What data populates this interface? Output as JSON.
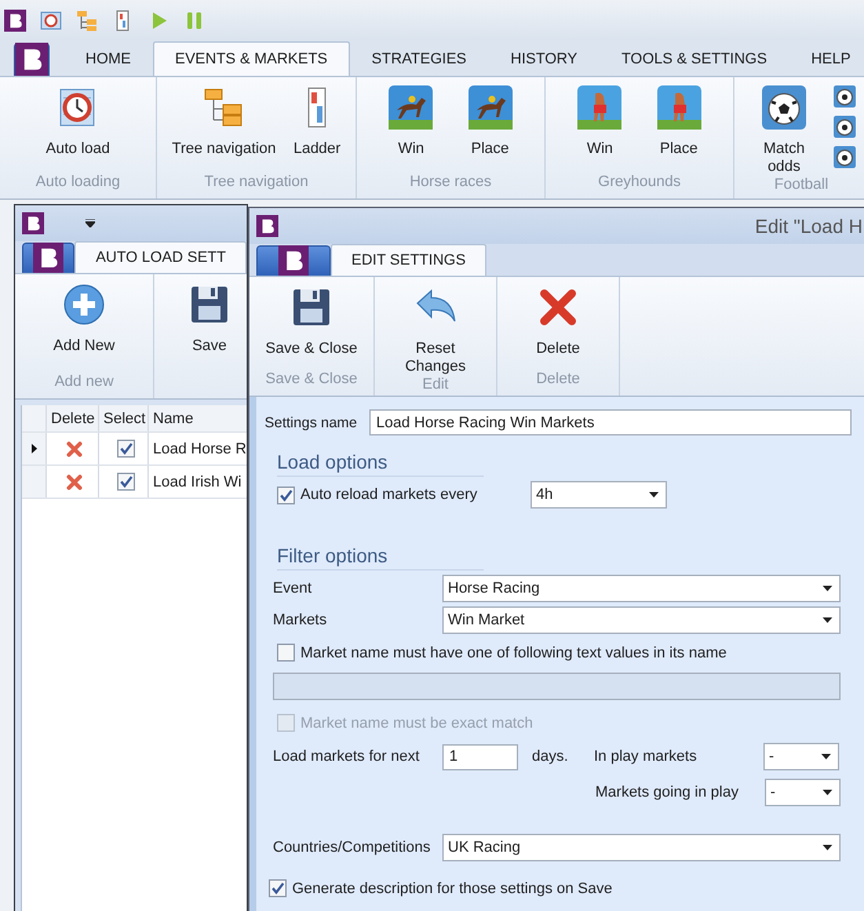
{
  "app": {
    "tabs": [
      {
        "label": "HOME",
        "selected": false
      },
      {
        "label": "EVENTS & MARKETS",
        "selected": true
      },
      {
        "label": "STRATEGIES",
        "selected": false
      },
      {
        "label": "HISTORY",
        "selected": false
      },
      {
        "label": "TOOLS & SETTINGS",
        "selected": false
      },
      {
        "label": "HELP",
        "selected": false
      }
    ],
    "ribbon": [
      {
        "label": "Auto loading",
        "buttons": [
          {
            "kind": "autoload",
            "label": "Auto load"
          }
        ]
      },
      {
        "label": "Tree navigation",
        "buttons": [
          {
            "kind": "tree",
            "label": "Tree navigation"
          },
          {
            "kind": "ladder",
            "label": "Ladder"
          }
        ]
      },
      {
        "label": "Horse races",
        "buttons": [
          {
            "kind": "horse",
            "label": "Win"
          },
          {
            "kind": "horse",
            "label": "Place"
          }
        ]
      },
      {
        "label": "Greyhounds",
        "buttons": [
          {
            "kind": "greyhound",
            "label": "Win"
          },
          {
            "kind": "greyhound",
            "label": "Place"
          }
        ]
      },
      {
        "label": "Football",
        "buttons": [
          {
            "kind": "ball",
            "label": "Match odds"
          },
          {
            "kind": "ball-stack"
          }
        ]
      }
    ]
  },
  "auto_load_window": {
    "tabs": [
      {
        "label": "AUTO LOAD SETT",
        "selected": true
      }
    ],
    "ribbon": [
      {
        "label": "Add new",
        "buttons": [
          {
            "kind": "add",
            "label": "Add New"
          }
        ]
      },
      {
        "buttons": [
          {
            "kind": "save",
            "label": "Save"
          }
        ]
      }
    ],
    "grid": {
      "columns": [
        "Delete",
        "Select",
        "Name"
      ],
      "rows": [
        {
          "name": "Load Horse R",
          "selected": true,
          "checked": true
        },
        {
          "name": "Load Irish Wi",
          "selected": false,
          "checked": true
        }
      ]
    }
  },
  "edit_window": {
    "title": "Edit \"Load H",
    "tabs": [
      {
        "label": "EDIT SETTINGS",
        "selected": true
      }
    ],
    "ribbon": [
      {
        "label": "Save & Close",
        "buttons": [
          {
            "kind": "save",
            "label": "Save & Close"
          }
        ]
      },
      {
        "label": "Edit",
        "buttons": [
          {
            "kind": "undo",
            "label": "Reset Changes"
          }
        ]
      },
      {
        "label": "Delete",
        "buttons": [
          {
            "kind": "delete",
            "label": "Delete"
          }
        ]
      }
    ],
    "form": {
      "settings_name": {
        "label": "Settings name",
        "value": "Load Horse Racing Win Markets"
      },
      "load_options": {
        "heading": "Load options",
        "auto_reload": {
          "label": "Auto reload markets every",
          "checked": true,
          "value": "4h"
        }
      },
      "filter_options": {
        "heading": "Filter options",
        "event": {
          "label": "Event",
          "value": "Horse Racing"
        },
        "markets": {
          "label": "Markets",
          "value": "Win Market"
        },
        "name_filter": {
          "label": "Market name must have one of following text values in its name",
          "checked": false
        },
        "exact_match": {
          "label": "Market name must be exact match",
          "checked": false,
          "disabled": true
        },
        "load_next": {
          "label": "Load markets for next",
          "value": "1",
          "unit": "days."
        },
        "in_play": {
          "label": "In play markets",
          "value": "-"
        },
        "going_in_play": {
          "label": "Markets going in play",
          "value": "-"
        },
        "countries": {
          "label": "Countries/Competitions",
          "value": "UK Racing"
        }
      },
      "generate_description": {
        "label": "Generate description for those settings on Save",
        "checked": true
      }
    }
  }
}
